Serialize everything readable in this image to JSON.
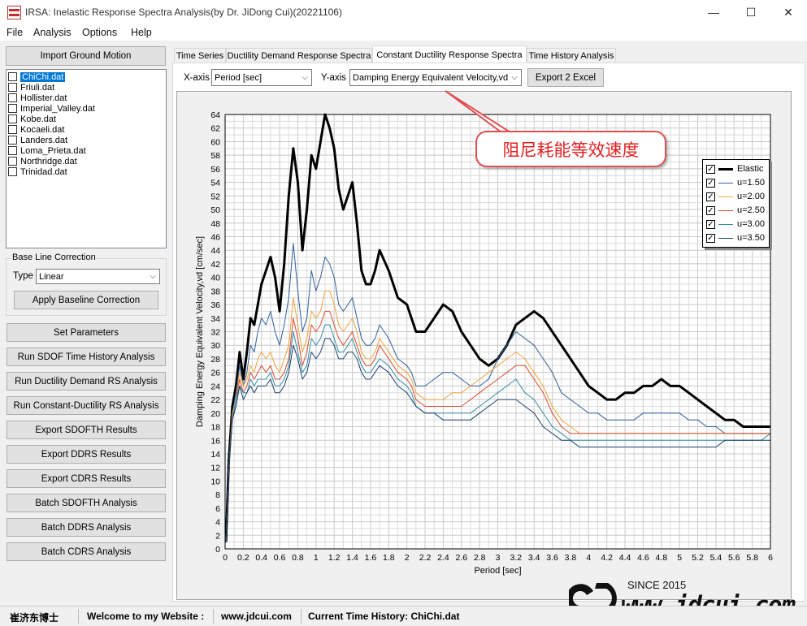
{
  "window": {
    "title": "IRSA: Inelastic Response Spectra Analysis(by Dr. JiDong Cui)(20221106)",
    "minimize": "—",
    "maximize": "☐",
    "close": "✕"
  },
  "menu": [
    "File",
    "Analysis",
    "Options",
    "Help"
  ],
  "left": {
    "import_button": "Import Ground Motion",
    "files": [
      "ChiChi.dat",
      "Friuli.dat",
      "Hollister.dat",
      "Imperial_Valley.dat",
      "Kobe.dat",
      "Kocaeli.dat",
      "Landers.dat",
      "Loma_Prieta.dat",
      "Northridge.dat",
      "Trinidad.dat"
    ],
    "selected_file": "ChiChi.dat",
    "baseline": {
      "group_title": "Base Line Correction",
      "type_label": "Type",
      "type_value": "Linear",
      "apply_button": "Apply Baseline Correction"
    },
    "buttons": [
      "Set Parameters",
      "Run SDOF Time History Analysis",
      "Run Ductility Demand RS Analysis",
      "Run Constant-Ductility RS Analysis",
      "Export SDOFTH Results",
      "Export DDRS Results",
      "Export CDRS Results",
      "Batch SDOFTH Analysis",
      "Batch DDRS Analysis",
      "Batch CDRS Analysis"
    ]
  },
  "tabs": [
    {
      "label": "Time Series"
    },
    {
      "label": "Ductility Demand Response Spectra"
    },
    {
      "label": "Constant Ductility Response Spectra",
      "active": true
    },
    {
      "label": "Time History Analysis"
    }
  ],
  "controls": {
    "xaxis_label": "X-axis",
    "xaxis_value": "Period [sec]",
    "yaxis_label": "Y-axis",
    "yaxis_value": "Damping  Energy Equivalent Velocity,vd",
    "export_button": "Export 2 Excel"
  },
  "annotation": "阻尼耗能等效速度",
  "chart_data": {
    "type": "line",
    "xlabel": "Period [sec]",
    "ylabel": "Damping  Energy Equivalent Velocity,vd [cm/sec]",
    "xlim": [
      0,
      6
    ],
    "ylim": [
      0,
      64
    ],
    "xticks": [
      "0",
      "0.2",
      "0.4",
      "0.6",
      "0.8",
      "1",
      "1.2",
      "1.4",
      "1.6",
      "1.8",
      "2",
      "2.2",
      "2.4",
      "2.6",
      "2.8",
      "3",
      "3.2",
      "3.4",
      "3.6",
      "3.8",
      "4",
      "4.2",
      "4.4",
      "4.6",
      "4.8",
      "5",
      "5.2",
      "5.4",
      "5.6",
      "5.8",
      "6"
    ],
    "yticks": [
      0,
      2,
      4,
      6,
      8,
      10,
      12,
      14,
      16,
      18,
      20,
      22,
      24,
      26,
      28,
      30,
      32,
      34,
      36,
      38,
      40,
      42,
      44,
      46,
      48,
      50,
      52,
      54,
      56,
      58,
      60,
      62,
      64
    ],
    "grid": true,
    "legend_position": "top-right",
    "series": [
      {
        "name": "Elastic",
        "color": "#000000",
        "width": 3,
        "x": [
          0.01,
          0.04,
          0.08,
          0.12,
          0.16,
          0.2,
          0.24,
          0.28,
          0.32,
          0.36,
          0.4,
          0.45,
          0.5,
          0.55,
          0.6,
          0.65,
          0.7,
          0.75,
          0.8,
          0.85,
          0.9,
          0.95,
          1.0,
          1.05,
          1.1,
          1.15,
          1.2,
          1.25,
          1.3,
          1.35,
          1.4,
          1.45,
          1.5,
          1.55,
          1.6,
          1.65,
          1.7,
          1.8,
          1.9,
          2.0,
          2.05,
          2.1,
          2.2,
          2.3,
          2.4,
          2.5,
          2.6,
          2.7,
          2.8,
          2.9,
          3.0,
          3.1,
          3.2,
          3.3,
          3.4,
          3.5,
          3.6,
          3.7,
          3.8,
          3.9,
          4.0,
          4.1,
          4.2,
          4.3,
          4.4,
          4.5,
          4.6,
          4.7,
          4.8,
          4.9,
          5.0,
          5.1,
          5.2,
          5.3,
          5.4,
          5.5,
          5.6,
          5.7,
          5.8,
          5.9,
          6.0
        ],
        "y": [
          1,
          13,
          21,
          24,
          29,
          25,
          29,
          34,
          33,
          36,
          39,
          41,
          43,
          40,
          35,
          42,
          52,
          59,
          54,
          44,
          50,
          58,
          56,
          60,
          64,
          62,
          59,
          53,
          50,
          52,
          54,
          48,
          41,
          39,
          39,
          41,
          44,
          41,
          37,
          36,
          34,
          32,
          32,
          34,
          36,
          35,
          32,
          30,
          28,
          27,
          28,
          30,
          33,
          34,
          35,
          34,
          32,
          30,
          28,
          26,
          24,
          23,
          22,
          22,
          23,
          23,
          24,
          24,
          25,
          24,
          24,
          23,
          22,
          21,
          20,
          19,
          19,
          18,
          18,
          18,
          18
        ]
      },
      {
        "name": "u=1.50",
        "color": "#2d5f9a",
        "width": 1,
        "x": [
          0.01,
          0.04,
          0.08,
          0.12,
          0.16,
          0.2,
          0.24,
          0.28,
          0.32,
          0.36,
          0.4,
          0.45,
          0.5,
          0.55,
          0.6,
          0.65,
          0.7,
          0.75,
          0.8,
          0.85,
          0.9,
          0.95,
          1.0,
          1.05,
          1.1,
          1.15,
          1.2,
          1.25,
          1.3,
          1.35,
          1.4,
          1.45,
          1.5,
          1.55,
          1.6,
          1.65,
          1.7,
          1.8,
          1.9,
          2.0,
          2.05,
          2.1,
          2.2,
          2.3,
          2.4,
          2.5,
          2.6,
          2.7,
          2.8,
          2.9,
          3.0,
          3.1,
          3.2,
          3.3,
          3.4,
          3.5,
          3.6,
          3.7,
          3.8,
          3.9,
          4.0,
          4.1,
          4.2,
          4.3,
          4.4,
          4.5,
          4.6,
          4.7,
          4.8,
          4.9,
          5.0,
          5.1,
          5.2,
          5.3,
          5.4,
          5.5,
          5.6,
          5.7,
          5.8,
          5.9,
          6.0
        ],
        "y": [
          1,
          12,
          20,
          23,
          27,
          24,
          26,
          30,
          29,
          32,
          34,
          33,
          35,
          32,
          30,
          33,
          37,
          45,
          38,
          32,
          34,
          41,
          38,
          40,
          43,
          42,
          40,
          36,
          35,
          36,
          37,
          34,
          31,
          30,
          30,
          31,
          33,
          31,
          28,
          27,
          26,
          24,
          24,
          25,
          26,
          26,
          25,
          24,
          24,
          25,
          28,
          30,
          32,
          31,
          30,
          28,
          26,
          23,
          22,
          21,
          20,
          20,
          19,
          19,
          19,
          19,
          20,
          20,
          20,
          20,
          20,
          19,
          19,
          18,
          18,
          17,
          17,
          17,
          17,
          17,
          17
        ]
      },
      {
        "name": "u=2.00",
        "color": "#f2a43a",
        "width": 1,
        "x": [
          0.01,
          0.04,
          0.08,
          0.12,
          0.16,
          0.2,
          0.24,
          0.28,
          0.32,
          0.36,
          0.4,
          0.45,
          0.5,
          0.55,
          0.6,
          0.65,
          0.7,
          0.75,
          0.8,
          0.85,
          0.9,
          0.95,
          1.0,
          1.05,
          1.1,
          1.15,
          1.2,
          1.25,
          1.3,
          1.35,
          1.4,
          1.45,
          1.5,
          1.55,
          1.6,
          1.65,
          1.7,
          1.8,
          1.9,
          2.0,
          2.05,
          2.1,
          2.2,
          2.3,
          2.4,
          2.5,
          2.6,
          2.7,
          2.8,
          2.9,
          3.0,
          3.1,
          3.2,
          3.3,
          3.4,
          3.5,
          3.6,
          3.7,
          3.8,
          3.9,
          4.0,
          4.1,
          4.2,
          4.3,
          4.4,
          4.5,
          4.6,
          4.7,
          4.8,
          4.9,
          5.0,
          5.1,
          5.2,
          5.3,
          5.4,
          5.5,
          5.6,
          5.7,
          5.8,
          5.9,
          6.0
        ],
        "y": [
          1,
          12,
          20,
          22,
          26,
          24,
          25,
          27,
          26,
          28,
          29,
          28,
          29,
          27,
          26,
          28,
          30,
          37,
          33,
          29,
          31,
          35,
          34,
          35,
          38,
          38,
          36,
          33,
          32,
          33,
          34,
          32,
          29,
          28,
          28,
          29,
          31,
          29,
          27,
          26,
          25,
          23,
          22,
          22,
          22,
          23,
          23,
          24,
          25,
          26,
          27,
          28,
          29,
          28,
          26,
          24,
          21,
          19,
          18,
          17,
          17,
          17,
          17,
          17,
          17,
          17,
          17,
          17,
          17,
          17,
          17,
          17,
          17,
          17,
          17,
          17,
          17,
          17,
          17,
          17,
          17
        ]
      },
      {
        "name": "u=2.50",
        "color": "#d84a2f",
        "width": 1,
        "x": [
          0.01,
          0.04,
          0.08,
          0.12,
          0.16,
          0.2,
          0.24,
          0.28,
          0.32,
          0.36,
          0.4,
          0.45,
          0.5,
          0.55,
          0.6,
          0.65,
          0.7,
          0.75,
          0.8,
          0.85,
          0.9,
          0.95,
          1.0,
          1.05,
          1.1,
          1.15,
          1.2,
          1.25,
          1.3,
          1.35,
          1.4,
          1.45,
          1.5,
          1.55,
          1.6,
          1.65,
          1.7,
          1.8,
          1.9,
          2.0,
          2.05,
          2.1,
          2.2,
          2.3,
          2.4,
          2.5,
          2.6,
          2.7,
          2.8,
          2.9,
          3.0,
          3.1,
          3.2,
          3.3,
          3.4,
          3.5,
          3.6,
          3.7,
          3.8,
          3.9,
          4.0,
          4.1,
          4.2,
          4.3,
          4.4,
          4.5,
          4.6,
          4.7,
          4.8,
          4.9,
          5.0,
          5.1,
          5.2,
          5.3,
          5.4,
          5.5,
          5.6,
          5.7,
          5.8,
          5.9,
          6.0
        ],
        "y": [
          1,
          12,
          19,
          22,
          25,
          23,
          24,
          26,
          25,
          26,
          27,
          26,
          27,
          25,
          25,
          26,
          28,
          34,
          31,
          27,
          29,
          33,
          32,
          33,
          35,
          35,
          33,
          31,
          30,
          31,
          32,
          30,
          28,
          27,
          27,
          28,
          30,
          28,
          26,
          25,
          24,
          22,
          21,
          21,
          21,
          21,
          21,
          22,
          23,
          24,
          25,
          26,
          27,
          27,
          25,
          23,
          20,
          18,
          17,
          17,
          17,
          17,
          17,
          17,
          17,
          17,
          17,
          17,
          17,
          17,
          17,
          17,
          17,
          17,
          17,
          17,
          17,
          17,
          17,
          17,
          17
        ]
      },
      {
        "name": "u=3.00",
        "color": "#2f8ca8",
        "width": 1,
        "x": [
          0.01,
          0.04,
          0.08,
          0.12,
          0.16,
          0.2,
          0.24,
          0.28,
          0.32,
          0.36,
          0.4,
          0.45,
          0.5,
          0.55,
          0.6,
          0.65,
          0.7,
          0.75,
          0.8,
          0.85,
          0.9,
          0.95,
          1.0,
          1.05,
          1.1,
          1.15,
          1.2,
          1.25,
          1.3,
          1.35,
          1.4,
          1.45,
          1.5,
          1.55,
          1.6,
          1.65,
          1.7,
          1.8,
          1.9,
          2.0,
          2.05,
          2.1,
          2.2,
          2.3,
          2.4,
          2.5,
          2.6,
          2.7,
          2.8,
          2.9,
          3.0,
          3.1,
          3.2,
          3.3,
          3.4,
          3.5,
          3.6,
          3.7,
          3.8,
          3.9,
          4.0,
          4.1,
          4.2,
          4.3,
          4.4,
          4.5,
          4.6,
          4.7,
          4.8,
          4.9,
          5.0,
          5.1,
          5.2,
          5.3,
          5.4,
          5.5,
          5.6,
          5.7,
          5.8,
          5.9,
          6.0
        ],
        "y": [
          1,
          12,
          19,
          22,
          24,
          23,
          23,
          25,
          24,
          25,
          25,
          25,
          26,
          24,
          24,
          25,
          27,
          32,
          29,
          26,
          27,
          31,
          30,
          31,
          33,
          33,
          31,
          29,
          29,
          30,
          31,
          29,
          27,
          26,
          26,
          27,
          28,
          27,
          25,
          24,
          23,
          21,
          20,
          20,
          20,
          20,
          20,
          20,
          21,
          22,
          23,
          24,
          25,
          23,
          22,
          20,
          18,
          17,
          16,
          16,
          16,
          16,
          16,
          16,
          16,
          16,
          16,
          16,
          16,
          16,
          16,
          16,
          16,
          16,
          16,
          16,
          16,
          16,
          16,
          16,
          17
        ]
      },
      {
        "name": "u=3.50",
        "color": "#1a3f6e",
        "width": 1,
        "x": [
          0.01,
          0.04,
          0.08,
          0.12,
          0.16,
          0.2,
          0.24,
          0.28,
          0.32,
          0.36,
          0.4,
          0.45,
          0.5,
          0.55,
          0.6,
          0.65,
          0.7,
          0.75,
          0.8,
          0.85,
          0.9,
          0.95,
          1.0,
          1.05,
          1.1,
          1.15,
          1.2,
          1.25,
          1.3,
          1.35,
          1.4,
          1.45,
          1.5,
          1.55,
          1.6,
          1.65,
          1.7,
          1.8,
          1.9,
          2.0,
          2.05,
          2.1,
          2.2,
          2.3,
          2.4,
          2.5,
          2.6,
          2.7,
          2.8,
          2.9,
          3.0,
          3.1,
          3.2,
          3.3,
          3.4,
          3.5,
          3.6,
          3.7,
          3.8,
          3.9,
          4.0,
          4.1,
          4.2,
          4.3,
          4.4,
          4.5,
          4.6,
          4.7,
          4.8,
          4.9,
          5.0,
          5.1,
          5.2,
          5.3,
          5.4,
          5.5,
          5.6,
          5.7,
          5.8,
          5.9,
          6.0
        ],
        "y": [
          1,
          12,
          19,
          21,
          24,
          22,
          23,
          24,
          23,
          24,
          24,
          24,
          25,
          23,
          23,
          24,
          26,
          30,
          28,
          25,
          26,
          29,
          28,
          29,
          31,
          31,
          30,
          28,
          28,
          29,
          29,
          28,
          26,
          25,
          25,
          26,
          27,
          26,
          24,
          23,
          22,
          21,
          20,
          20,
          19,
          19,
          19,
          19,
          20,
          21,
          22,
          22,
          22,
          21,
          20,
          18,
          17,
          16,
          16,
          15,
          15,
          15,
          15,
          15,
          15,
          15,
          15,
          15,
          15,
          15,
          15,
          15,
          15,
          15,
          15,
          16,
          16,
          16,
          16,
          16,
          16
        ]
      }
    ]
  },
  "status": {
    "author": "崔济东博士",
    "welcome": "Welcome to my Website :",
    "site": "www.jdcui.com",
    "current": "Current Time History: ChiChi.dat"
  },
  "watermark": {
    "since": "SINCE 2015",
    "url": "www.jdcui.com"
  }
}
